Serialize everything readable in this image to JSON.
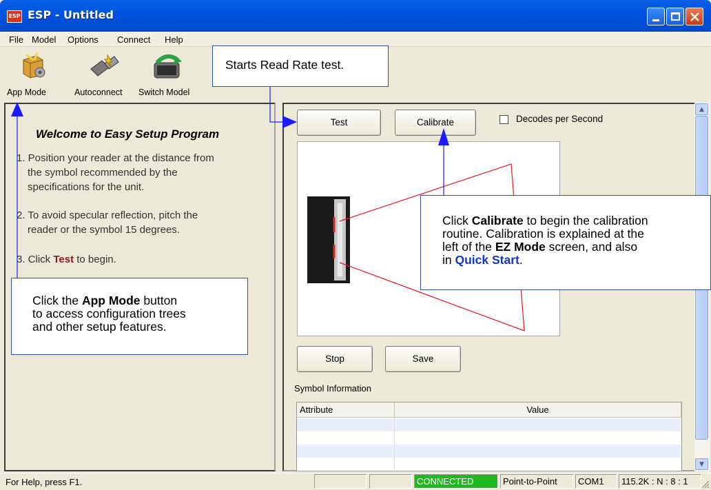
{
  "window": {
    "title": "ESP - Untitled",
    "app_icon_text": "ESP"
  },
  "menu": [
    "File",
    "Model",
    "Options",
    "Connect",
    "Help"
  ],
  "toolbar": {
    "app_mode": "App Mode",
    "autoconnect": "Autoconnect",
    "switch_model": "Switch Model"
  },
  "left": {
    "welcome": "Welcome to Easy Setup Program",
    "step1_l1": "1. Position your reader at the distance from",
    "step1_l2": "the symbol recommended by the",
    "step1_l3": "specifications for the unit.",
    "step2_l1": "2. To avoid specular reflection, pitch the",
    "step2_l2": "reader or the symbol 15 degrees.",
    "step3_pre": "3. Click ",
    "step3_bold": "Test",
    "step3_post": " to begin."
  },
  "right": {
    "test": "Test",
    "calibrate": "Calibrate",
    "decodes": "Decodes per Second",
    "decodes_checked": false,
    "stop": "Stop",
    "save": "Save",
    "symbol_info": "Symbol Information",
    "col_attribute": "Attribute",
    "col_value": "Value"
  },
  "callouts": {
    "read_rate": "Starts Read Rate test.",
    "app_mode_1": "Click the ",
    "app_mode_2": "App Mode",
    "app_mode_3": " button",
    "app_mode_4": "to access configuration trees",
    "app_mode_5": "and other setup features.",
    "cal_1": "Click ",
    "cal_2": "Calibrate",
    "cal_3": " to begin the calibration",
    "cal_4": "routine. Calibration is explained at the",
    "cal_5": "left of the ",
    "cal_6": "EZ Mode",
    "cal_7": " screen, and also",
    "cal_8": "in ",
    "cal_9": "Quick Start",
    "cal_10": "."
  },
  "status": {
    "help": "For Help, press F1.",
    "connected": "CONNECTED",
    "mode": "Point-to-Point",
    "port": "COM1",
    "settings": "115.2K : N : 8 : 1"
  },
  "colors": {
    "titlebar": "#0054e3",
    "connected": "#22b822",
    "callout_border": "#2f4fa8",
    "arrow": "#1a1aff",
    "test_text": "#8b1a1a"
  }
}
